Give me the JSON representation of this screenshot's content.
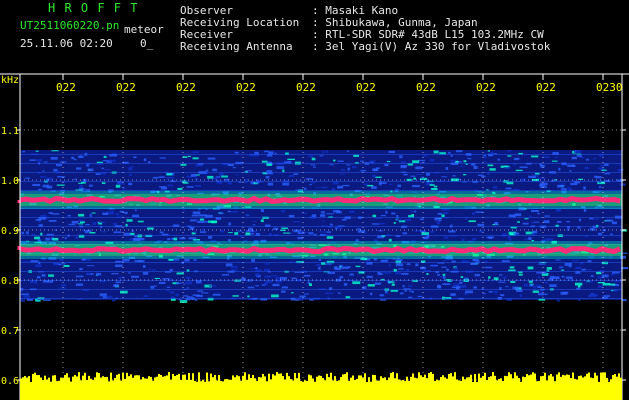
{
  "header": {
    "logo": "H R O F F T",
    "filename": "UT2511060220.pn",
    "suffix": "meteor",
    "datetime": "25.11.06 02:20",
    "frame_marker": "0_",
    "info": [
      {
        "label": "Observer",
        "value": ": Masaki Kano"
      },
      {
        "label": "Receiving Location",
        "value": ": Shibukawa, Gunma, Japan"
      },
      {
        "label": "Receiver",
        "value": ": RTL-SDR SDR# 43dB L15 103.2MHz CW"
      },
      {
        "label": "Receiving Antenna",
        "value": ": 3el Yagi(V) Az 330 for Vladivostok"
      }
    ]
  },
  "spectrogram": {
    "unit": "kHz",
    "y_ticks": [
      "1.1",
      "1.0",
      "0.9",
      "0.8",
      "0.7",
      "0.6"
    ],
    "time_ticks": [
      "022",
      "022",
      "022",
      "022",
      "022",
      "022",
      "022",
      "022",
      "022",
      "0230"
    ],
    "bands": [
      {
        "freq_khz": 0.96,
        "color": "#ff2a78"
      },
      {
        "freq_khz": 0.86,
        "color": "#ff2a78"
      }
    ],
    "signal_range_khz": [
      0.76,
      1.06
    ],
    "audio_level_color": "#ffff00",
    "colors": {
      "background": "#000000",
      "grid": "#ffffff",
      "tick_labels": "#ffff00",
      "logo": "#2ee82e",
      "noise_low": "#0a1a80",
      "noise_mid": "#2a5fff",
      "noise_high": "#00ffcc"
    }
  }
}
